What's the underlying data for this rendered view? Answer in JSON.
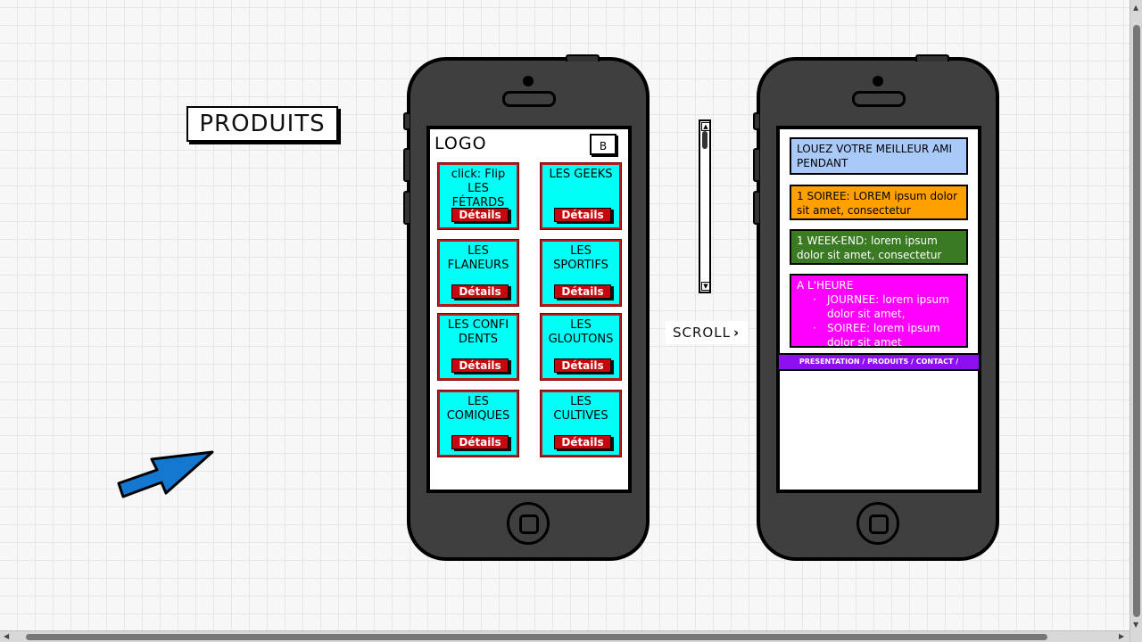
{
  "page": {
    "title": "PRODUITS"
  },
  "phone_left": {
    "logo": "LOGO",
    "menu_button": "B",
    "cards": [
      {
        "title": "click: Flip LES FÉTARDS",
        "button": "Détails"
      },
      {
        "title": "LES GEEKS",
        "button": "Détails"
      },
      {
        "title": "LES FLANEURS",
        "button": "Détails"
      },
      {
        "title": "LES SPORTIFS",
        "button": "Détails"
      },
      {
        "title": "LES CONFIDENTS",
        "button": "Détails"
      },
      {
        "title": "LES GLOUTONS",
        "button": "Détails"
      },
      {
        "title": "LES COMIQUES",
        "button": "Détails"
      },
      {
        "title": "LES CULTIVES",
        "button": "Détails"
      }
    ]
  },
  "scroll_label": "SCROLL",
  "phone_right": {
    "blocks": [
      {
        "text": "LOUEZ VOTRE MEILLEUR AMI PENDANT",
        "color": "#a9c9f8"
      },
      {
        "text": "1 SOIREE: LOREM ipsum dolor sit amet, consectetur",
        "color": "#ffa000"
      },
      {
        "text": "1 WEEK-END: lorem ipsum dolor sit amet, consectetur",
        "color": "#3a7a23"
      },
      {
        "text": "A L'HEURE",
        "items": [
          "JOURNEE: lorem ipsum dolor sit amet,",
          "SOIREE: lorem ipsum dolor sit amet"
        ],
        "color": "#ff00ff"
      }
    ],
    "footer": "PRESENTATION / PRODUITS / CONTACT / COPYRIGHT"
  },
  "colors": {
    "card_bg": "#00fff6",
    "card_border": "#b71c1c",
    "detail_button": "#c4080e",
    "arrow": "#1477d0",
    "phone_body": "#3f3f3f"
  },
  "icons": {
    "pointer": "arrow-icon",
    "scroll_chevron": "chevron-right-icon"
  }
}
